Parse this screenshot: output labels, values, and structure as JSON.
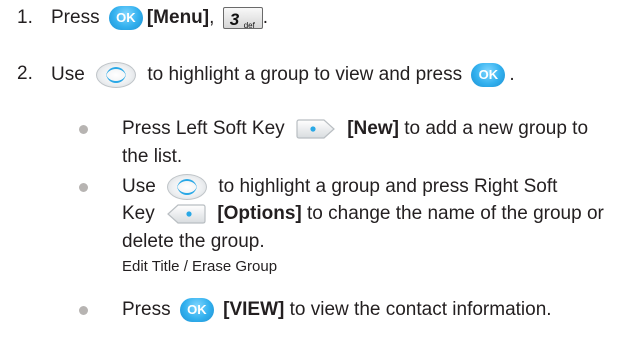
{
  "steps": [
    {
      "number": "1.",
      "text_press": "Press",
      "ok_label": "OK",
      "menu_label": "[Menu]",
      "sep": ",",
      "key_digit": "3",
      "key_letters": "def",
      "end": "."
    },
    {
      "number": "2.",
      "text_use": "Use",
      "text_mid": "to highlight a group to view and press",
      "ok_label": "OK",
      "end": "."
    }
  ],
  "bullets": [
    {
      "pre": "Press Left Soft Key",
      "bold": "[New]",
      "post": "to add a new group to",
      "line2": "the list."
    },
    {
      "pre": "Use",
      "post": "to highlight a group and press Right Soft",
      "line2_pre": "Key",
      "line2_bold": "[Options]",
      "line2_post": "to change the name of the group or",
      "line3": "delete the group.",
      "sub": "Edit Title / Erase Group"
    },
    {
      "pre": "Press",
      "ok_label": "OK",
      "bold": "[VIEW]",
      "post": "to view the contact information."
    }
  ],
  "icons": {
    "ok": "ok-button-icon",
    "nav": "navigation-key-icon",
    "left_soft": "left-soft-key-icon",
    "right_soft": "right-soft-key-icon",
    "key3": "key-3-def-icon"
  },
  "colors": {
    "ok_blue": "#32b0ee",
    "nav_arc": "#29a8e6",
    "bullet": "#b7b4b2",
    "text": "#231f20"
  }
}
